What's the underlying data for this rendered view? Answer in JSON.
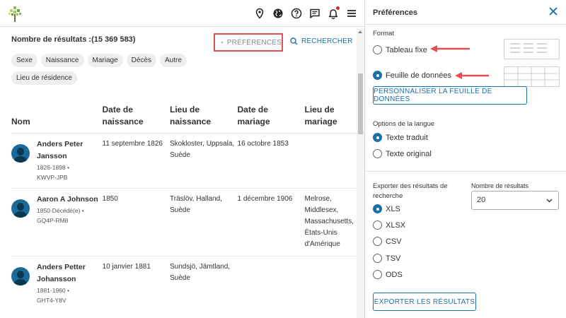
{
  "header": {
    "icons": [
      "logo-tree-icon",
      "location-pin-icon",
      "globe-icon",
      "help-icon",
      "message-icon",
      "bell-icon",
      "menu-icon"
    ]
  },
  "results": {
    "count_label": "Nombre de résultats :(15 369 583)",
    "preferences_label": "PRÉFÉRENCES",
    "search_label": "RECHERCHER",
    "chips": [
      "Sexe",
      "Naissance",
      "Mariage",
      "Décès",
      "Autre",
      "Lieu de résidence"
    ],
    "columns": [
      "Nom",
      "Date de naissance",
      "Lieu de naissance",
      "Date de mariage",
      "Lieu de mariage"
    ],
    "rows": [
      {
        "name": "Anders Peter Jansson",
        "meta": "1826-1898 •",
        "id": "KWVP-JPB",
        "birth_date": "11 septembre 1826",
        "birth_place": "Skokloster, Uppsala, Suède",
        "marriage_date": "16 octobre 1853",
        "marriage_place": ""
      },
      {
        "name": "Aaron A Johnson",
        "meta": "1850-Décédé(e) •",
        "id": "GQ4P-RM8",
        "birth_date": "1850",
        "birth_place": "Träslöv, Halland, Suède",
        "marriage_date": "1 décembre 1906",
        "marriage_place": "Melrose, Middlesex, Massachusetts, États-Unis d'Amérique"
      },
      {
        "name": "Anders Petter Johansson",
        "meta": "1881-1960 •",
        "id": "GHT4-Y8V",
        "birth_date": "10 janvier 1881",
        "birth_place": "Sundsjö, Jämtland, Suède",
        "marriage_date": "",
        "marriage_place": ""
      }
    ]
  },
  "panel": {
    "title": "Préférences",
    "format_label": "Format",
    "format_options": [
      {
        "label": "Tableau fixe",
        "selected": false
      },
      {
        "label": "Feuille de données",
        "selected": true
      }
    ],
    "customize_button": "PERSONNALISER LA FEUILLE DE DONNÉES",
    "language_label": "Options de la langue",
    "language_options": [
      {
        "label": "Texte traduit",
        "selected": true
      },
      {
        "label": "Texte original",
        "selected": false
      }
    ],
    "export_label": "Exporter des résultats de recherche",
    "export_options": [
      {
        "label": "XLS",
        "selected": true
      },
      {
        "label": "XLSX",
        "selected": false
      },
      {
        "label": "CSV",
        "selected": false
      },
      {
        "label": "TSV",
        "selected": false
      },
      {
        "label": "ODS",
        "selected": false
      }
    ],
    "count_select_label": "Nombre de résultats",
    "count_select_value": "20",
    "export_button": "EXPORTER LES RÉSULTATS"
  },
  "colors": {
    "accent": "#1a6fa8",
    "highlight_box": "#e0514f",
    "annotation_arrow": "#e0514f",
    "notification_dot": "#d6273b"
  }
}
